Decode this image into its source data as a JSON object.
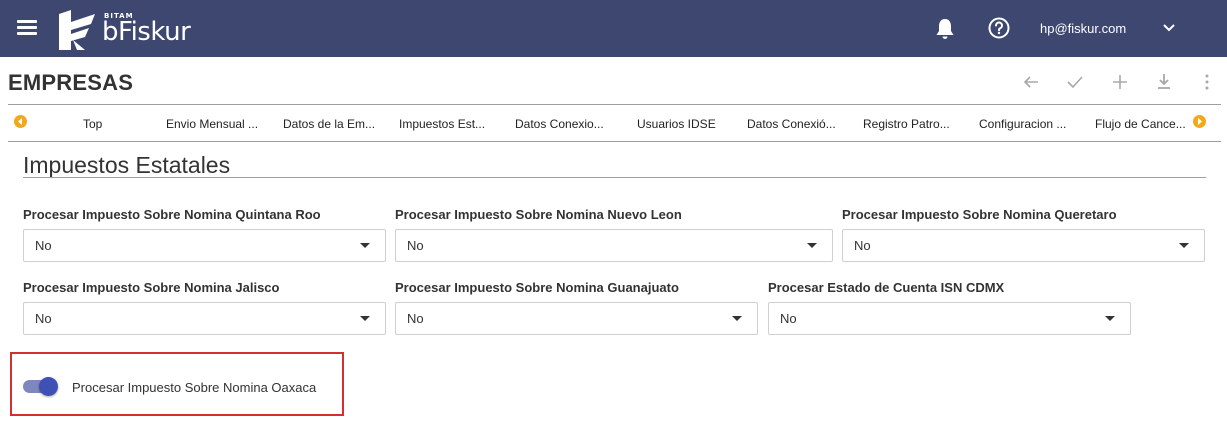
{
  "header": {
    "brand_small": "BITAM",
    "brand": "bFiskur",
    "user_email": "hp@fiskur.com"
  },
  "page": {
    "title": "EMPRESAS"
  },
  "toolbar_icons": [
    "back-arrow-icon",
    "check-icon",
    "plus-icon",
    "download-icon",
    "more-vertical-icon"
  ],
  "tabs": [
    {
      "label": "Top"
    },
    {
      "label": "Envio Mensual ..."
    },
    {
      "label": "Datos de la Em..."
    },
    {
      "label": "Impuestos Est..."
    },
    {
      "label": "Datos Conexio..."
    },
    {
      "label": "Usuarios IDSE"
    },
    {
      "label": "Datos Conexió..."
    },
    {
      "label": "Registro Patro..."
    },
    {
      "label": "Configuracion ..."
    },
    {
      "label": "Flujo de Cance..."
    }
  ],
  "section": {
    "title": "Impuestos Estatales"
  },
  "fields": [
    {
      "label": "Procesar Impuesto Sobre Nomina Quintana Roo",
      "value": "No"
    },
    {
      "label": "Procesar Impuesto Sobre Nomina Nuevo Leon",
      "value": "No"
    },
    {
      "label": "Procesar Impuesto Sobre Nomina Queretaro",
      "value": "No"
    },
    {
      "label": "Procesar Impuesto Sobre Nomina Jalisco",
      "value": "No"
    },
    {
      "label": "Procesar Impuesto Sobre Nomina Guanajuato",
      "value": "No"
    },
    {
      "label": "Procesar Estado de Cuenta ISN CDMX",
      "value": "No"
    }
  ],
  "toggle": {
    "label": "Procesar Impuesto Sobre Nomina Oaxaca",
    "on": true
  },
  "colors": {
    "header_bg": "#3d4770",
    "accent": "#3f51b5",
    "tab_arrow": "#f2a81d",
    "highlight_border": "#d32f2f"
  }
}
